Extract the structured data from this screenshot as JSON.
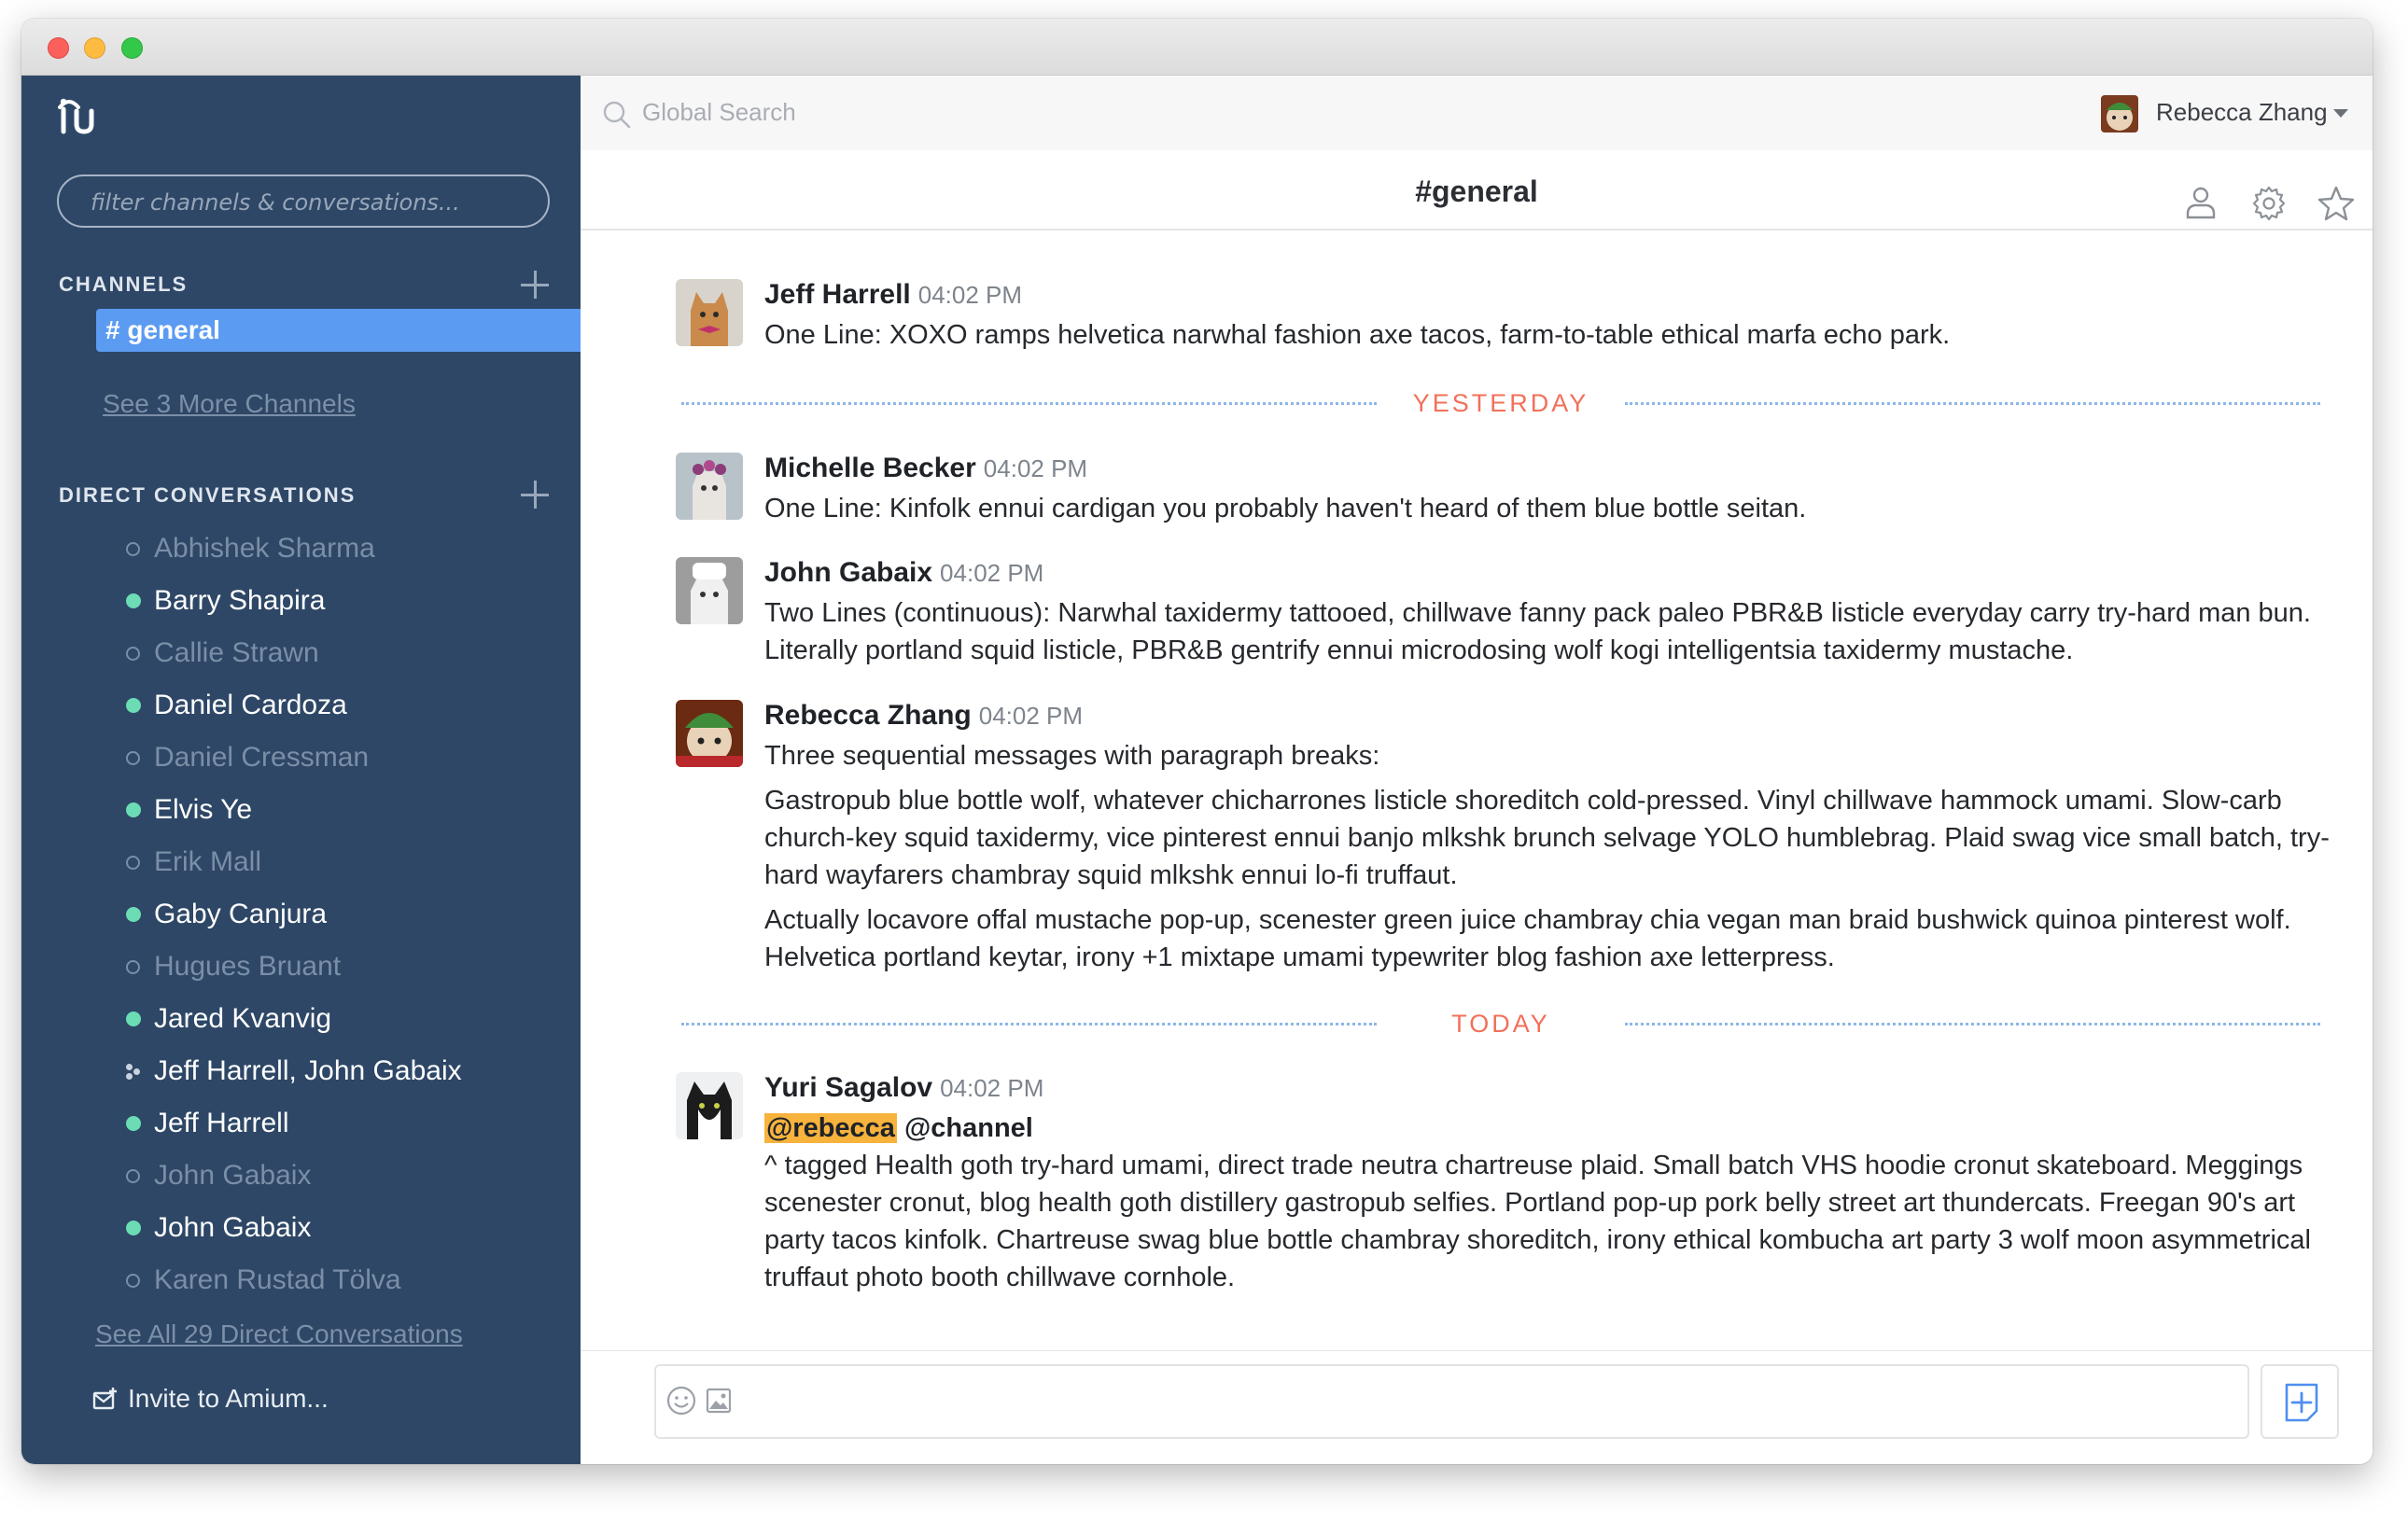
{
  "app": {
    "title_bar": ""
  },
  "sidebar": {
    "filter_placeholder": "filter channels & conversations...",
    "channels_header": "CHANNELS",
    "active_channel": "# general",
    "more_channels": "See 3 More Channels",
    "direct_header": "DIRECT CONVERSATIONS",
    "direct_conversations": [
      {
        "name": "Abhishek Sharma",
        "status": "offline"
      },
      {
        "name": "Barry Shapira",
        "status": "online"
      },
      {
        "name": "Callie Strawn",
        "status": "offline"
      },
      {
        "name": "Daniel Cardoza",
        "status": "online"
      },
      {
        "name": "Daniel Cressman",
        "status": "offline"
      },
      {
        "name": "Elvis Ye",
        "status": "online"
      },
      {
        "name": "Erik Mall",
        "status": "offline"
      },
      {
        "name": "Gaby Canjura",
        "status": "online"
      },
      {
        "name": "Hugues Bruant",
        "status": "offline"
      },
      {
        "name": "Jared Kvanvig",
        "status": "online"
      },
      {
        "name": "Jeff Harrell, John Gabaix",
        "status": "group"
      },
      {
        "name": "Jeff Harrell",
        "status": "online"
      },
      {
        "name": "John Gabaix",
        "status": "offline"
      },
      {
        "name": "John Gabaix",
        "status": "online"
      },
      {
        "name": "Karen Rustad Tölva",
        "status": "offline"
      }
    ],
    "see_all": "See All 29 Direct Conversations",
    "invite": "Invite to Amium..."
  },
  "topbar": {
    "search_placeholder": "Global Search",
    "user_name": "Rebecca Zhang"
  },
  "channel": {
    "title": "#general"
  },
  "dividers": {
    "yesterday": "YESTERDAY",
    "today": "TODAY"
  },
  "messages": [
    {
      "author": "Jeff Harrell",
      "time": "04:02 PM",
      "lines": [
        "One Line: XOXO ramps helvetica narwhal fashion axe tacos, farm-to-table ethical marfa echo park."
      ]
    },
    {
      "author": "Michelle Becker",
      "time": "04:02 PM",
      "lines": [
        "One Line: Kinfolk ennui cardigan you probably haven't heard of them blue bottle seitan."
      ]
    },
    {
      "author": "John Gabaix",
      "time": "04:02 PM",
      "lines": [
        "Two Lines (continuous): Narwhal taxidermy tattooed, chillwave fanny pack paleo PBR&B listicle everyday carry try-hard man bun. Literally portland squid listicle, PBR&B gentrify ennui microdosing wolf kogi intelligentsia taxidermy mustache."
      ]
    },
    {
      "author": "Rebecca Zhang",
      "time": "04:02 PM",
      "lines": [
        "Three sequential messages with paragraph breaks:",
        "Gastropub blue bottle wolf, whatever chicharrones listicle shoreditch cold-pressed. Vinyl chillwave hammock umami. Slow-carb church-key squid taxidermy, vice pinterest ennui banjo mlkshk brunch selvage YOLO humblebrag. Plaid swag vice small batch, try-hard wayfarers chambray squid mlkshk ennui lo-fi truffaut.",
        "Actually locavore offal mustache pop-up, scenester green juice chambray chia vegan man braid bushwick quinoa pinterest wolf. Helvetica portland keytar, irony +1 mixtape umami typewriter blog fashion axe letterpress."
      ]
    },
    {
      "author": "Yuri Sagalov",
      "time": "04:02 PM",
      "mention_user": "@rebecca",
      "mention_channel": "@channel",
      "lines": [
        "^ tagged Health goth try-hard umami, direct trade neutra chartreuse plaid. Small batch VHS hoodie cronut skateboard. Meggings scenester cronut, blog health goth distillery gastropub selfies. Portland pop-up pork belly street art thundercats. Freegan 90's art party tacos kinfolk. Chartreuse swag blue bottle chambray shoreditch, irony ethical kombucha art party 3 wolf moon asymmetrical truffaut photo booth chillwave cornhole."
      ]
    }
  ],
  "colors": {
    "sidebar_bg": "#2e4766",
    "active_channel": "#5b9bf1",
    "online": "#6bdcb4",
    "divider_label": "#f2705a",
    "mention_bg": "#f7b33c"
  },
  "icons": {
    "search": "search-icon",
    "profile": "person-icon",
    "settings": "gear-icon",
    "favorite": "star-icon",
    "emoji": "smiley-icon",
    "image": "image-icon",
    "send": "add-note-icon",
    "invite": "invite-icon",
    "logo": "amium-logo-icon"
  }
}
